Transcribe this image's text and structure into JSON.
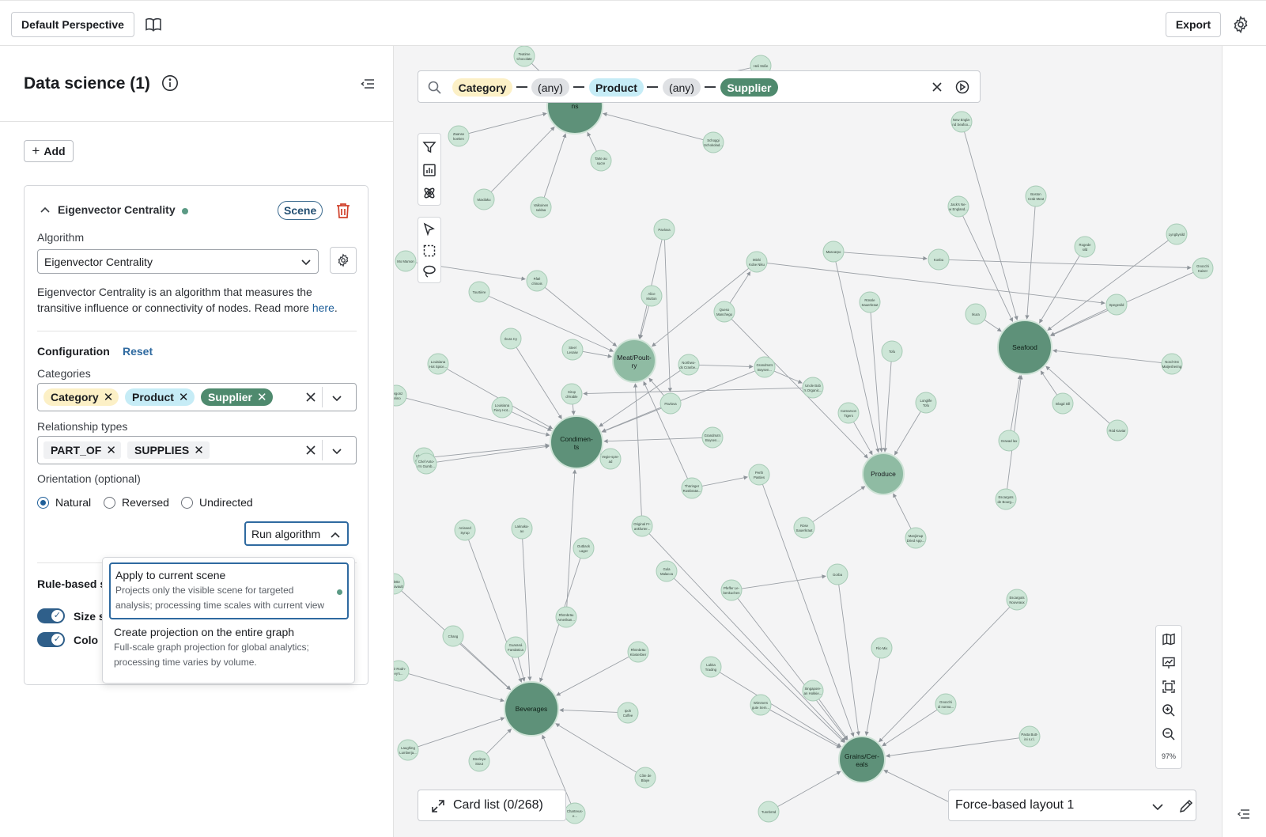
{
  "topbar": {
    "perspective_label": "Default Perspective",
    "export_label": "Export"
  },
  "panel": {
    "title": "Data science (1)",
    "add_label": "Add",
    "card": {
      "title": "Eigenvector Centrality",
      "scene_badge": "Scene",
      "algorithm_label": "Algorithm",
      "algorithm_value": "Eigenvector Centrality",
      "description": "Eigenvector Centrality is an algorithm that measures the transitive influence or connectivity of nodes. Read more ",
      "description_link": "here",
      "description_end": ".",
      "configuration_label": "Configuration",
      "reset_label": "Reset",
      "categories_label": "Categories",
      "categories": [
        "Category",
        "Product",
        "Supplier"
      ],
      "relationship_types_label": "Relationship types",
      "relationship_types": [
        "PART_OF",
        "SUPPLIES"
      ],
      "orientation_label": "Orientation (optional)",
      "orientation_options": [
        "Natural",
        "Reversed",
        "Undirected"
      ],
      "orientation_selected": "Natural",
      "run_label": "Run algorithm",
      "rule_based_label": "Rule-based s",
      "size_label": "Size s",
      "color_label": "Colo"
    },
    "run_dropdown": {
      "options": [
        {
          "title": "Apply to current scene",
          "desc_1": "Projects only the visible scene for targeted",
          "desc_2": "analysis; processing time scales with current view",
          "selected": true
        },
        {
          "title": "Create projection on the entire graph",
          "desc_1": "Full-scale graph projection for global analytics;",
          "desc_2": "processing time varies by volume.",
          "selected": false
        }
      ]
    }
  },
  "search": {
    "tokens": [
      "Category",
      "(any)",
      "Product",
      "(any)",
      "Supplier"
    ]
  },
  "canvas": {
    "zoom_level": "97%",
    "card_list_label": "Card list (0/268)",
    "layout_label": "Force-based layout 1",
    "colors": {
      "category_node": "#5e9179",
      "product_node": "#cde6d7",
      "node_stroke": "#a7cbb6",
      "edge": "#9ba0a6",
      "chip_category": "#fcf0c6",
      "chip_product": "#c6ecf6",
      "chip_supplier": "#4f8a6e"
    },
    "big_nodes": [
      {
        "label_1": "ns",
        "label_2": ""
      },
      {
        "label_1": "Condimen-",
        "label_2": "ts"
      },
      {
        "label_1": "Seafood",
        "label_2": ""
      },
      {
        "label_1": "Beverages",
        "label_2": ""
      },
      {
        "label_1": "Grains/Cer-",
        "label_2": "eals"
      },
      {
        "label_1": "Meat/Poult-",
        "label_2": "ry"
      },
      {
        "label_1": "Produce",
        "label_2": ""
      }
    ],
    "small_nodes": [
      {
        "l1": "Teatime",
        "l2": "Chocolate"
      },
      {
        "l1": "Heli Süße",
        "l2": ""
      },
      {
        "l1": "Zaanse",
        "l2": "koeken"
      },
      {
        "l1": "Schoggi",
        "l2": "Schokolad..."
      },
      {
        "l1": "New Engla-",
        "l2": "nd Seafoo..."
      },
      {
        "l1": "Tarte au",
        "l2": "sucre"
      },
      {
        "l1": "Maxilaku",
        "l2": ""
      },
      {
        "l1": "Valkoinen",
        "l2": "suklaa"
      },
      {
        "l1": "Jack's Ne-",
        "l2": "w England..."
      },
      {
        "l1": "Boston",
        "l2": "Crab Meat"
      },
      {
        "l1": "Pavlova",
        "l2": ""
      },
      {
        "l1": "Lyngbysild",
        "l2": ""
      },
      {
        "l1": "Rogede",
        "l2": "sild"
      },
      {
        "l1": "Nord-Ost",
        "l2": "Matjeshering"
      },
      {
        "l1": "Mishi",
        "l2": "Kobe Niku"
      },
      {
        "l1": "Mascarpo",
        "l2": ""
      },
      {
        "l1": "Konbu",
        "l2": ""
      },
      {
        "l1": "Mo Mamon",
        "l2": ""
      },
      {
        "l1": "Pâté",
        "l2": "chinois"
      },
      {
        "l1": "Tourtière",
        "l2": ""
      },
      {
        "l1": "Ikura",
        "l2": ""
      },
      {
        "l1": "Spegesild",
        "l2": ""
      },
      {
        "l1": "Alice",
        "l2": "Mutton"
      },
      {
        "l1": "Queso",
        "l2": "Manchego"
      },
      {
        "l1": "Gnocchi",
        "l2": "Kaiser"
      },
      {
        "l1": "Tofu",
        "l2": ""
      },
      {
        "l1": "Ikura Cy",
        "l2": ""
      },
      {
        "l1": "Rössle",
        "l2": "Sauerkraut"
      },
      {
        "l1": "Steel",
        "l2": "Lesaiw"
      },
      {
        "l1": "Louisiana",
        "l2": "Hot Spice..."
      },
      {
        "l1": "Northwo-",
        "l2": "ds Cranbe..."
      },
      {
        "l1": "Grandma's",
        "l2": "Boysen..."
      },
      {
        "l1": "Uncle Bob",
        "l2": "'s Organic..."
      },
      {
        "l1": "Longlife",
        "l2": "Tofu"
      },
      {
        "l1": "Inlagd Sill",
        "l2": ""
      },
      {
        "l1": "Chef Anto-",
        "l2": "n's Cajun..."
      },
      {
        "l1": "Louisiana",
        "l2": "Fiery Hot..."
      },
      {
        "l1": "Pavlova",
        "l2": ""
      },
      {
        "l1": "Carnarvon",
        "l2": "Tigers"
      },
      {
        "l1": "Gravad lax",
        "l2": ""
      },
      {
        "l1": "Röd Kaviar",
        "l2": ""
      },
      {
        "l1": "Sirop",
        "l2": "d'érable"
      },
      {
        "l1": "Vegie-spre-",
        "l2": "ad"
      },
      {
        "l1": "Grandma's",
        "l2": "Boysen..."
      },
      {
        "l1": "Perth",
        "l2": "Pasties"
      },
      {
        "l1": "Thüringer",
        "l2": "Rostbratw..."
      },
      {
        "l1": "Escargots",
        "l2": "de Bourg..."
      },
      {
        "l1": "Escargots",
        "l2": "Nouveaux"
      },
      {
        "l1": "Gorgonz",
        "l2": "Telino"
      },
      {
        "l1": "Chef Anto-",
        "l2": "n's Gumb..."
      },
      {
        "l1": "Aniseed",
        "l2": "Syrup"
      },
      {
        "l1": "Laknaka-",
        "l2": "ao"
      },
      {
        "l1": "Original Fr-",
        "l2": "ankfurter..."
      },
      {
        "l1": "Röse",
        "l2": "Sauerkraut"
      },
      {
        "l1": "Manjimup",
        "l2": "Dried App..."
      },
      {
        "l1": "Outback",
        "l2": "Lager"
      },
      {
        "l1": "Gula",
        "l2": "Malacca"
      },
      {
        "l1": "Pfeffer Le-",
        "l2": "benkuchen"
      },
      {
        "l1": "Gorba",
        "l2": ""
      },
      {
        "l1": "Chang",
        "l2": ""
      },
      {
        "l1": "Rhönbräu",
        "l2": "Klosterbier"
      },
      {
        "l1": "Guaraná",
        "l2": "Fantástica"
      },
      {
        "l1": "Lakka",
        "l2": "Trading"
      },
      {
        "l1": "Filo Mix",
        "l2": ""
      },
      {
        "l1": "Ipoh",
        "l2": "Coffee"
      },
      {
        "l1": "Wimmers",
        "l2": "gute Sem..."
      },
      {
        "l1": "Singapore-",
        "l2": "an Hokkie..."
      },
      {
        "l1": "Gnocchi",
        "l2": "di nonna..."
      },
      {
        "l1": "Laughing",
        "l2": "Lumberja..."
      },
      {
        "l1": "Steeleye",
        "l2": "Stout"
      },
      {
        "l1": "Côte de",
        "l2": "Blaye"
      },
      {
        "l1": "Pasta Butt-",
        "l2": "ini s.r.l."
      },
      {
        "l1": "Chartreus-",
        "l2": "e..."
      },
      {
        "l1": "Tunnbröd",
        "l2": ""
      },
      {
        "l1": "Angelo",
        "l2": ""
      },
      {
        "l1": "Raclette",
        "l2": "Courdavault"
      },
      {
        "l1": "Sir Rodn-",
        "l2": "ey's..."
      },
      {
        "l1": "Rhönbräu",
        "l2": "Amerikan..."
      }
    ]
  }
}
